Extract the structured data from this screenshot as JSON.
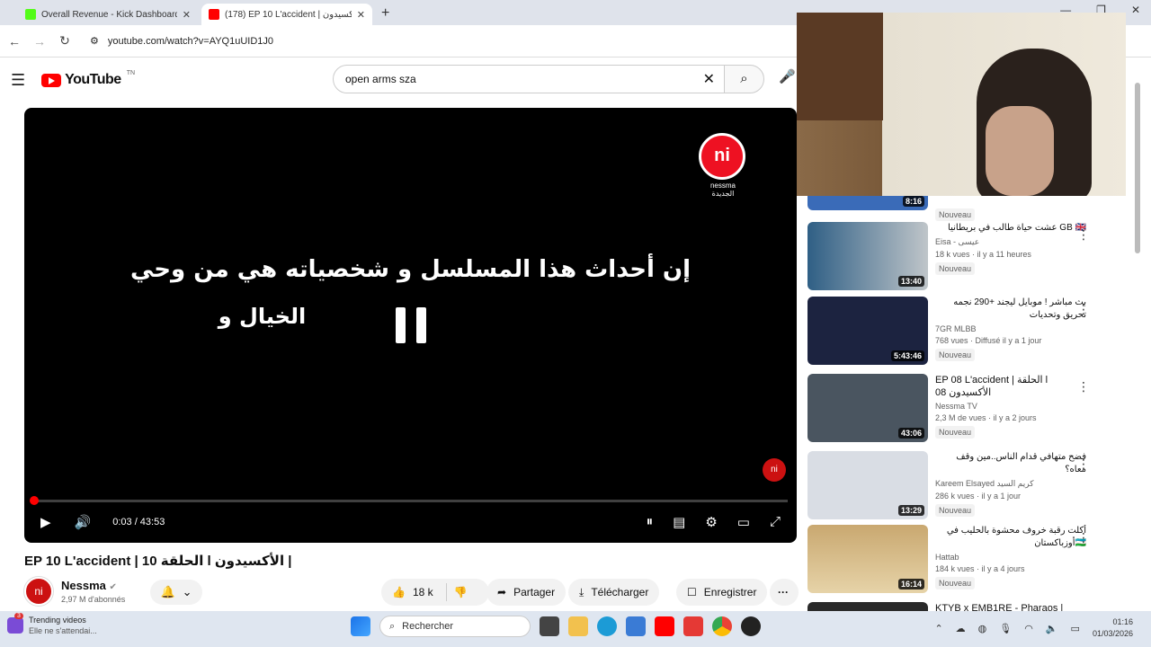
{
  "browser": {
    "tabs": [
      {
        "title": "Overall Revenue - Kick Dashboard",
        "favicon_color": "#53fc18"
      },
      {
        "title": "(178) EP 10 L'accident | أكسيدون ...",
        "favicon_color": "#ff0000"
      }
    ],
    "new_tab": "+",
    "url": "youtube.com/watch?v=AYQ1uUID1J0"
  },
  "youtube": {
    "logo_text": "YouTube",
    "logo_region": "TN",
    "search_query": "open arms sza"
  },
  "player": {
    "subtitle_line1": "إن أحداث هذا المسلسل و شخصياته هي من وحي",
    "subtitle_line2": "الخيال و",
    "channel_logo_text": "ni",
    "channel_logo_caption": "nessma الجديدة",
    "time": "0:03 / 43:53",
    "progress_fraction": 0.001
  },
  "video": {
    "title": "EP 10 L'accident | الحلقة 10 l الأكسيدون |",
    "channel": "Nessma",
    "subscribers": "2,97 M d'abonnés",
    "likes": "18 k",
    "share": "Partager",
    "download": "Télécharger",
    "save": "Enregistrer"
  },
  "recommendations": [
    {
      "title": "",
      "channel": "",
      "views": "",
      "badge": "Nouveau",
      "duration": "8:16",
      "color": "#3a6bb8"
    },
    {
      "title": "عشت حياة طالب في بريطانيا GB 🇬🇧",
      "channel": "Eisa - عيسى",
      "views": "18 k vues · il y a 11 heures",
      "badge": "Nouveau",
      "duration": "13:40",
      "color": "#2f5f85"
    },
    {
      "title": "بث مباشر ! موبايل ليجند +290 نجمه تحريق وتحديات",
      "channel": "7GR MLBB",
      "views": "768 vues · Diffusé il y a 1 jour",
      "badge": "Nouveau",
      "duration": "5:43:46",
      "color": "#1c2340"
    },
    {
      "title": "EP 08 L'accident | الحلقة l الأكسيدون 08",
      "channel": "Nessma TV",
      "views": "2,3 M de vues · il y a 2 jours",
      "badge": "Nouveau",
      "duration": "43:06",
      "color": "#4a5560"
    },
    {
      "title": "فضح متهافي قدام الناس..مين وقف معاه؟",
      "channel": "Kareem Elsayed كريم السيد",
      "views": "286 k vues · il y a 1 jour",
      "badge": "Nouveau",
      "duration": "13:29",
      "color": "#d9dde4"
    },
    {
      "title": "أكلت رقبة خروف محشوة بالحليب في أوزباكستان🇺🇿",
      "channel": "Hattab",
      "views": "184 k vues · il y a 4 jours",
      "badge": "Nouveau",
      "duration": "16:14",
      "color": "#c9a870"
    },
    {
      "title": "KTYB x EMB1RE - Pharaos |",
      "channel": "",
      "views": "",
      "badge": "",
      "duration": "",
      "color": "#2a2a2a"
    }
  ],
  "taskbar": {
    "notif_title": "Trending videos",
    "notif_sub": "Elle ne s'attendai...",
    "notif_count": "3",
    "search_placeholder": "Rechercher",
    "time": "01:16",
    "date": "01/03/2026"
  }
}
